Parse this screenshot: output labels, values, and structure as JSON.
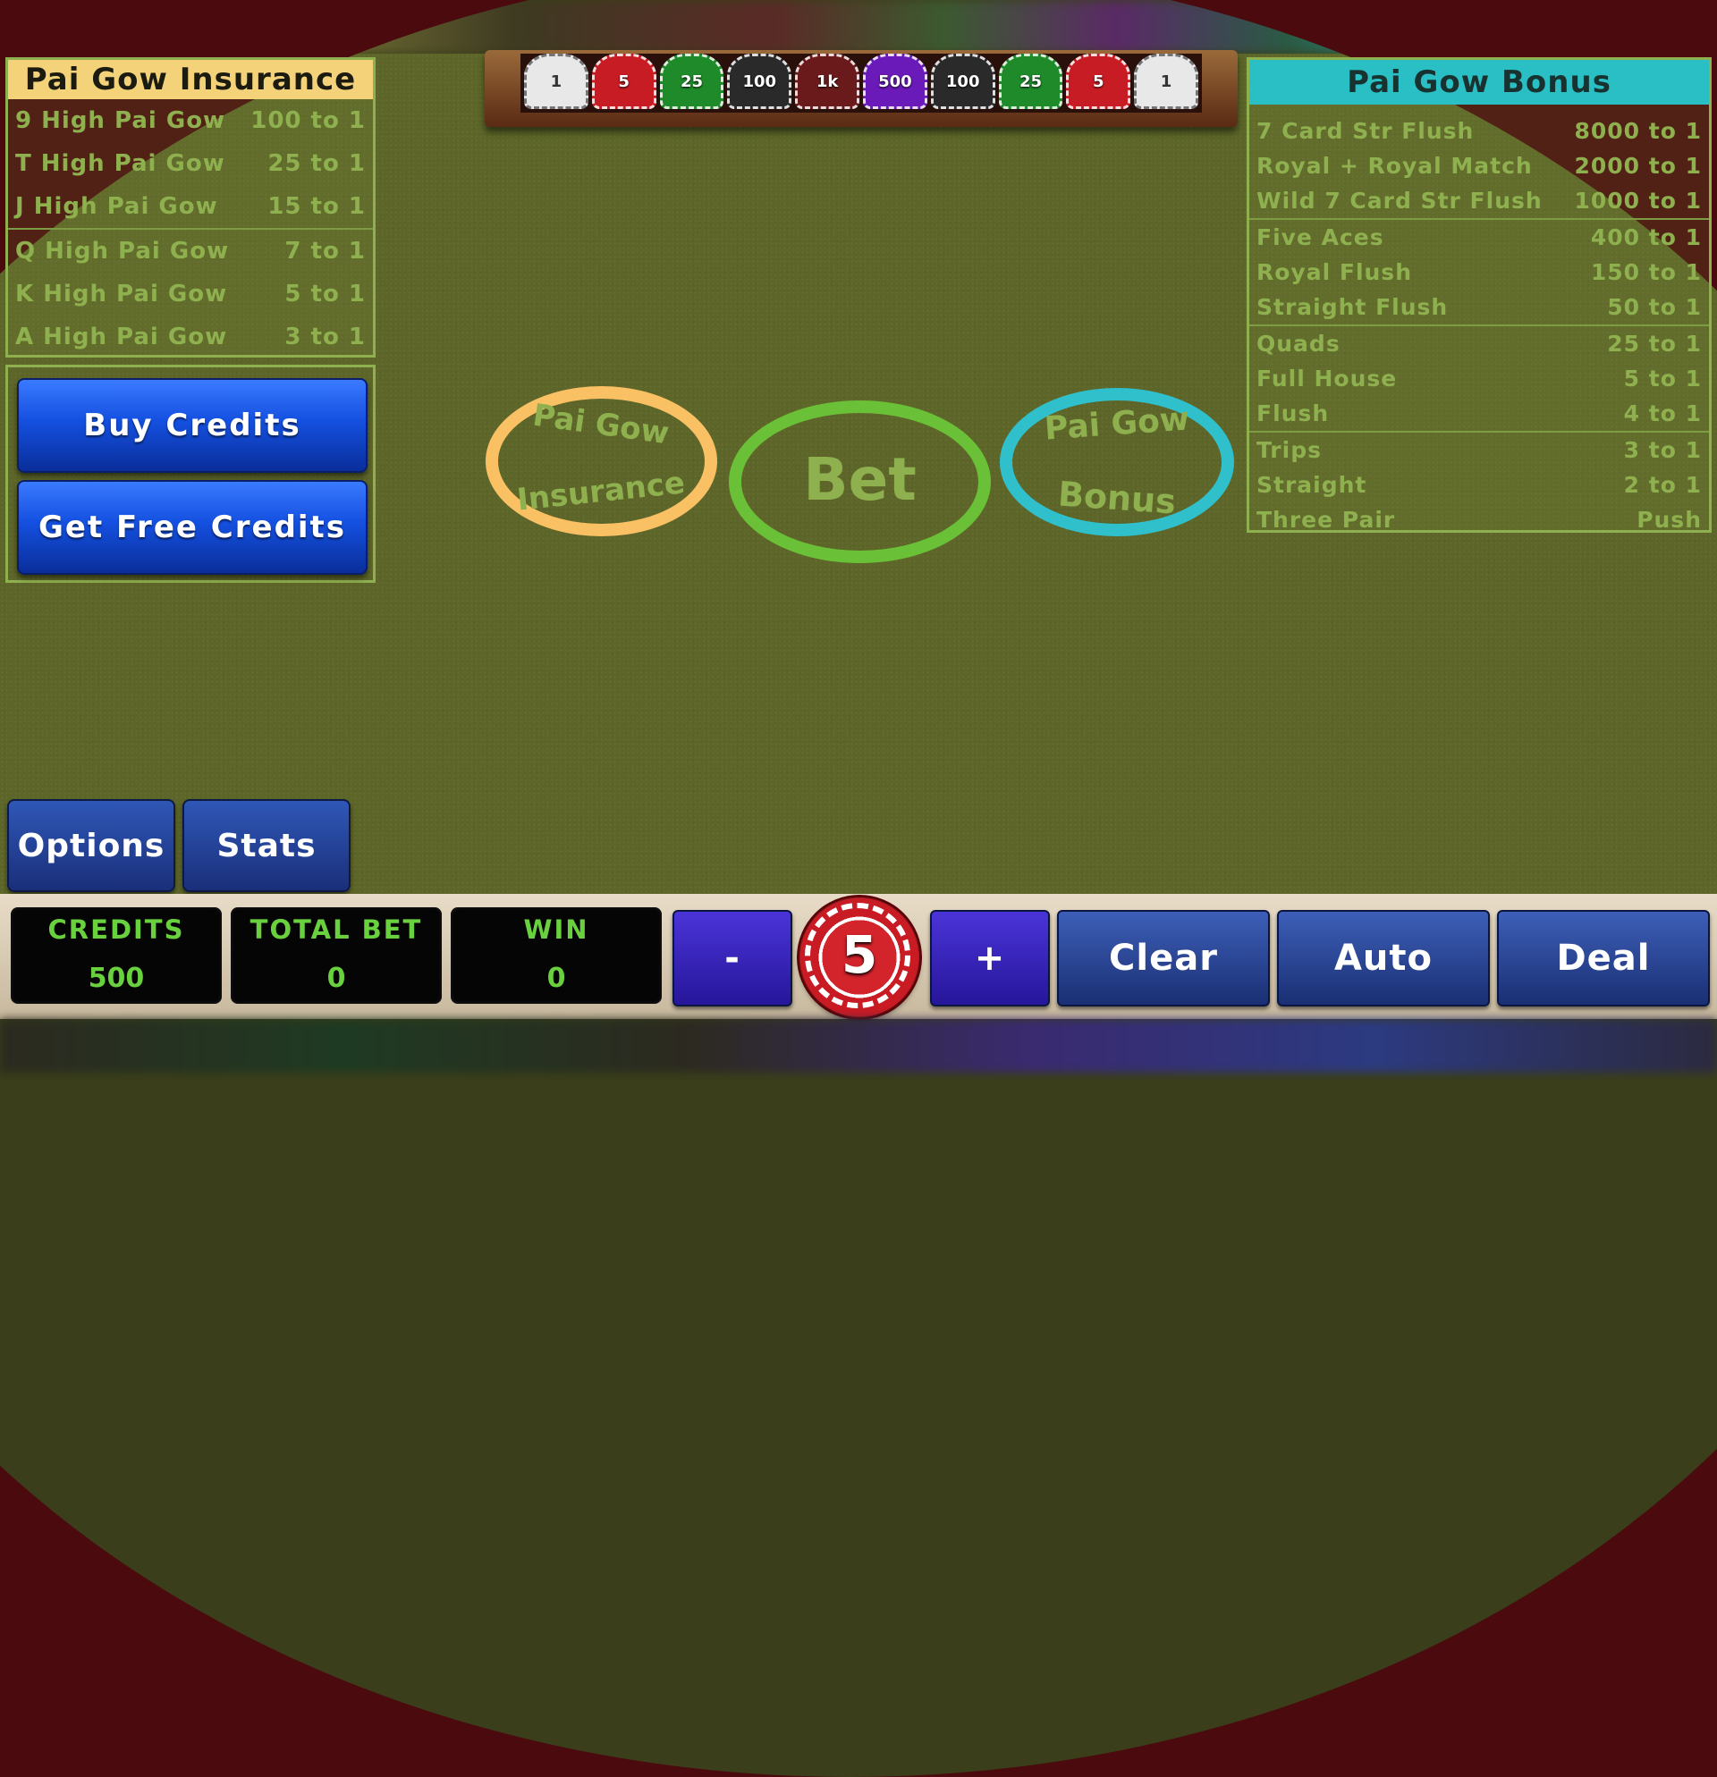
{
  "insurance_table": {
    "title": "Pai Gow Insurance",
    "rows": [
      {
        "hand": "9 High Pai Gow",
        "pays": "100 to 1"
      },
      {
        "hand": "T High Pai Gow",
        "pays": "25 to 1"
      },
      {
        "hand": "J High Pai Gow",
        "pays": "15 to 1"
      },
      {
        "hand": "Q High Pai Gow",
        "pays": "7 to 1"
      },
      {
        "hand": "K High Pai Gow",
        "pays": "5 to 1"
      },
      {
        "hand": "A High Pai Gow",
        "pays": "3 to 1"
      }
    ]
  },
  "bonus_table": {
    "title": "Pai Gow Bonus",
    "rows": [
      {
        "hand": "7 Card Str Flush",
        "pays": "8000 to 1"
      },
      {
        "hand": "Royal + Royal Match",
        "pays": "2000 to 1"
      },
      {
        "hand": "Wild 7 Card Str Flush",
        "pays": "1000 to 1"
      },
      {
        "hand": "Five Aces",
        "pays": "400 to 1"
      },
      {
        "hand": "Royal Flush",
        "pays": "150 to 1"
      },
      {
        "hand": "Straight Flush",
        "pays": "50 to 1"
      },
      {
        "hand": "Quads",
        "pays": "25 to 1"
      },
      {
        "hand": "Full House",
        "pays": "5 to 1"
      },
      {
        "hand": "Flush",
        "pays": "4 to 1"
      },
      {
        "hand": "Trips",
        "pays": "3 to 1"
      },
      {
        "hand": "Straight",
        "pays": "2 to 1"
      },
      {
        "hand": "Three Pair",
        "pays": "Push"
      }
    ]
  },
  "credit_buttons": {
    "buy": "Buy Credits",
    "free": "Get Free Credits"
  },
  "bet_spots": {
    "insurance_top": "Pai Gow",
    "insurance_bottom": "Insurance",
    "bet": "Bet",
    "bonus_top": "Pai Gow",
    "bonus_bottom": "Bonus"
  },
  "chip_rack": [
    {
      "label": "1",
      "color": "#e8e8e8"
    },
    {
      "label": "5",
      "color": "#c81c24"
    },
    {
      "label": "25",
      "color": "#1f8a2a"
    },
    {
      "label": "100",
      "color": "#2a2a2a"
    },
    {
      "label": "1k",
      "color": "#6a1a1a"
    },
    {
      "label": "500",
      "color": "#6a1ab8"
    },
    {
      "label": "100",
      "color": "#2a2a2a"
    },
    {
      "label": "25",
      "color": "#1f8a2a"
    },
    {
      "label": "5",
      "color": "#c81c24"
    },
    {
      "label": "1",
      "color": "#e8e8e8"
    }
  ],
  "nav": {
    "options": "Options",
    "stats": "Stats"
  },
  "meters": {
    "credits_label": "CREDITS",
    "credits_value": "500",
    "total_bet_label": "TOTAL BET",
    "total_bet_value": "0",
    "win_label": "WIN",
    "win_value": "0"
  },
  "controls": {
    "decrease": "-",
    "chip_value": "5",
    "increase": "+",
    "clear": "Clear",
    "auto": "Auto",
    "deal": "Deal"
  }
}
